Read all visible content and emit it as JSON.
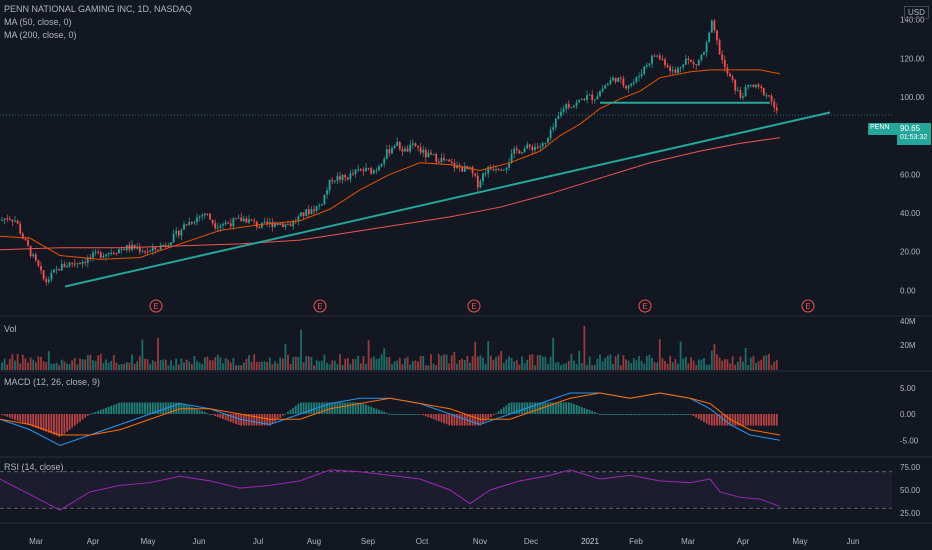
{
  "header": {
    "title_line": "PENN NATIONAL GAMING INC, 1D, NASDAQ",
    "ma50_label": "MA (50, close, 0)",
    "ma200_label": "MA (200, close, 0)",
    "currency": "USD"
  },
  "price_tag": {
    "ticker": "PENN",
    "price": "90.65",
    "countdown": "01:53:32"
  },
  "panes": {
    "vol_label": "Vol",
    "macd_label": "MACD (12, 26, close, 9)",
    "rsi_label": "RSI (14, close)"
  },
  "earnings_marker": "E",
  "colors": {
    "bg": "#131722",
    "up": "#26a69a",
    "down": "#ef5350",
    "ma50": "#e65100",
    "ma200": "#ef5350",
    "trend": "#26a69a",
    "macd": "#2196f3",
    "signal": "#ff6d00",
    "rsi": "#9c27b0",
    "grid": "#1e222d"
  },
  "chart_data": [
    {
      "type": "candlestick",
      "title": "PENN NATIONAL GAMING INC, 1D, NASDAQ",
      "y_ticks": [
        "140.00",
        "120.00",
        "100.00",
        "80.00",
        "60.00",
        "40.00",
        "20.00",
        "0.00"
      ],
      "ylim": [
        -5,
        145
      ],
      "x_ticks": [
        "Mar",
        "Apr",
        "May",
        "Jun",
        "Jul",
        "Aug",
        "Sep",
        "Oct",
        "Nov",
        "Dec",
        "2021",
        "Feb",
        "Mar",
        "Apr",
        "May",
        "Jun"
      ],
      "last_price": 90.65,
      "price_path": [
        [
          0,
          36
        ],
        [
          8,
          38
        ],
        [
          16,
          36
        ],
        [
          22,
          28
        ],
        [
          30,
          20
        ],
        [
          38,
          12
        ],
        [
          45,
          4
        ],
        [
          52,
          8
        ],
        [
          60,
          12
        ],
        [
          70,
          14
        ],
        [
          82,
          15
        ],
        [
          95,
          18
        ],
        [
          110,
          20
        ],
        [
          125,
          22
        ],
        [
          135,
          22
        ],
        [
          150,
          20
        ],
        [
          165,
          24
        ],
        [
          175,
          28
        ],
        [
          185,
          34
        ],
        [
          195,
          37
        ],
        [
          205,
          40
        ],
        [
          215,
          34
        ],
        [
          230,
          35
        ],
        [
          245,
          37
        ],
        [
          260,
          33
        ],
        [
          275,
          35
        ],
        [
          290,
          34
        ],
        [
          305,
          40
        ],
        [
          320,
          44
        ],
        [
          332,
          58
        ],
        [
          345,
          58
        ],
        [
          360,
          62
        ],
        [
          375,
          62
        ],
        [
          385,
          70
        ],
        [
          395,
          76
        ],
        [
          405,
          72
        ],
        [
          415,
          75
        ],
        [
          425,
          70
        ],
        [
          440,
          68
        ],
        [
          455,
          64
        ],
        [
          470,
          62
        ],
        [
          478,
          55
        ],
        [
          485,
          62
        ],
        [
          495,
          64
        ],
        [
          505,
          64
        ],
        [
          515,
          72
        ],
        [
          530,
          74
        ],
        [
          545,
          75
        ],
        [
          555,
          86
        ],
        [
          565,
          96
        ],
        [
          575,
          96
        ],
        [
          585,
          100
        ],
        [
          595,
          100
        ],
        [
          605,
          106
        ],
        [
          615,
          110
        ],
        [
          625,
          106
        ],
        [
          635,
          108
        ],
        [
          645,
          116
        ],
        [
          655,
          122
        ],
        [
          665,
          118
        ],
        [
          675,
          112
        ],
        [
          685,
          120
        ],
        [
          695,
          116
        ],
        [
          705,
          124
        ],
        [
          712,
          138
        ],
        [
          718,
          126
        ],
        [
          725,
          114
        ],
        [
          732,
          108
        ],
        [
          740,
          100
        ],
        [
          750,
          106
        ],
        [
          760,
          104
        ],
        [
          770,
          100
        ],
        [
          778,
          90
        ]
      ],
      "ma50": [
        [
          0,
          28
        ],
        [
          30,
          27
        ],
        [
          60,
          18
        ],
        [
          100,
          16
        ],
        [
          140,
          17
        ],
        [
          180,
          24
        ],
        [
          220,
          31
        ],
        [
          260,
          34
        ],
        [
          300,
          36
        ],
        [
          330,
          42
        ],
        [
          360,
          52
        ],
        [
          390,
          60
        ],
        [
          420,
          66
        ],
        [
          450,
          65
        ],
        [
          480,
          62
        ],
        [
          510,
          66
        ],
        [
          540,
          72
        ],
        [
          560,
          80
        ],
        [
          580,
          86
        ],
        [
          600,
          94
        ],
        [
          620,
          99
        ],
        [
          640,
          103
        ],
        [
          660,
          110
        ],
        [
          690,
          113
        ],
        [
          710,
          114
        ],
        [
          740,
          114
        ],
        [
          760,
          114
        ],
        [
          780,
          112
        ]
      ],
      "ma200": [
        [
          0,
          21
        ],
        [
          60,
          22
        ],
        [
          120,
          22
        ],
        [
          180,
          23
        ],
        [
          240,
          24
        ],
        [
          300,
          26
        ],
        [
          350,
          30
        ],
        [
          400,
          34
        ],
        [
          450,
          38
        ],
        [
          500,
          43
        ],
        [
          550,
          50
        ],
        [
          600,
          58
        ],
        [
          650,
          66
        ],
        [
          700,
          72
        ],
        [
          740,
          76
        ],
        [
          780,
          79
        ]
      ],
      "trendlines": [
        [
          [
            65,
            2
          ],
          [
            830,
            92
          ]
        ],
        [
          [
            600,
            97
          ],
          [
            770,
            97
          ]
        ]
      ],
      "earnings_x": [
        156,
        320,
        474,
        645,
        808
      ],
      "volume_ylim": [
        0,
        45
      ],
      "volume_ticks": [
        "40M",
        "20M"
      ],
      "macd_ticks": [
        "5.00",
        "0.00",
        "-5.00"
      ],
      "macd_ylim": [
        -8,
        8
      ],
      "macd_line": [
        [
          0,
          -1
        ],
        [
          30,
          -3
        ],
        [
          60,
          -6
        ],
        [
          90,
          -4
        ],
        [
          120,
          -2
        ],
        [
          150,
          0
        ],
        [
          180,
          2
        ],
        [
          210,
          1
        ],
        [
          240,
          -1
        ],
        [
          270,
          -2
        ],
        [
          300,
          0
        ],
        [
          330,
          2
        ],
        [
          360,
          3
        ],
        [
          390,
          3
        ],
        [
          420,
          2
        ],
        [
          450,
          0
        ],
        [
          480,
          -2
        ],
        [
          510,
          0
        ],
        [
          540,
          2
        ],
        [
          570,
          4
        ],
        [
          600,
          4
        ],
        [
          630,
          3
        ],
        [
          660,
          4
        ],
        [
          690,
          3
        ],
        [
          710,
          1
        ],
        [
          730,
          -2
        ],
        [
          750,
          -4
        ],
        [
          780,
          -5
        ]
      ],
      "signal_line": [
        [
          0,
          -1
        ],
        [
          30,
          -2
        ],
        [
          60,
          -4
        ],
        [
          90,
          -4
        ],
        [
          120,
          -3
        ],
        [
          150,
          -1
        ],
        [
          180,
          1
        ],
        [
          210,
          1
        ],
        [
          240,
          0
        ],
        [
          270,
          -1
        ],
        [
          300,
          -1
        ],
        [
          330,
          1
        ],
        [
          360,
          2
        ],
        [
          390,
          3
        ],
        [
          420,
          2
        ],
        [
          450,
          1
        ],
        [
          480,
          -1
        ],
        [
          510,
          -1
        ],
        [
          540,
          1
        ],
        [
          570,
          3
        ],
        [
          600,
          4
        ],
        [
          630,
          3
        ],
        [
          660,
          4
        ],
        [
          690,
          3
        ],
        [
          710,
          2
        ],
        [
          730,
          -1
        ],
        [
          750,
          -3
        ],
        [
          780,
          -4
        ]
      ],
      "rsi_ticks": [
        "75.00",
        "50.00",
        "25.00"
      ],
      "rsi_ylim": [
        15,
        85
      ],
      "rsi_bands": [
        70,
        30
      ],
      "rsi_line": [
        [
          0,
          62
        ],
        [
          30,
          45
        ],
        [
          60,
          28
        ],
        [
          90,
          48
        ],
        [
          120,
          55
        ],
        [
          150,
          58
        ],
        [
          180,
          65
        ],
        [
          210,
          60
        ],
        [
          240,
          52
        ],
        [
          270,
          55
        ],
        [
          300,
          60
        ],
        [
          330,
          72
        ],
        [
          360,
          70
        ],
        [
          390,
          66
        ],
        [
          420,
          62
        ],
        [
          450,
          50
        ],
        [
          470,
          35
        ],
        [
          490,
          50
        ],
        [
          520,
          60
        ],
        [
          550,
          66
        ],
        [
          570,
          72
        ],
        [
          600,
          62
        ],
        [
          630,
          66
        ],
        [
          660,
          60
        ],
        [
          690,
          58
        ],
        [
          710,
          62
        ],
        [
          720,
          48
        ],
        [
          740,
          42
        ],
        [
          760,
          40
        ],
        [
          780,
          32
        ]
      ]
    }
  ]
}
